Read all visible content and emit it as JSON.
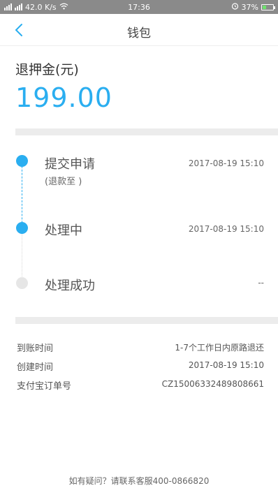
{
  "status_bar": {
    "network_speed": "42.0 K/s",
    "time": "17:36",
    "battery": "37%",
    "battery_level": 0.37,
    "battery_color": "#6ee26e"
  },
  "nav": {
    "title": "钱包",
    "back_icon": "chevron-left-icon"
  },
  "deposit": {
    "label": "退押金(元)",
    "amount": "199.00",
    "accent_color": "#2aaef0"
  },
  "timeline": [
    {
      "title": "提交申请",
      "subtitle": "(退款至 )",
      "time": "2017-08-19 15:10",
      "status": "done"
    },
    {
      "title": "处理中",
      "subtitle": "",
      "time": "2017-08-19 15:10",
      "status": "done"
    },
    {
      "title": "处理成功",
      "subtitle": "",
      "time": "--",
      "status": "pending"
    }
  ],
  "details": [
    {
      "label": "到账时间",
      "value": "1-7个工作日内原路退还"
    },
    {
      "label": "创建时间",
      "value": "2017-08-19 15:10"
    },
    {
      "label": "支付宝订单号",
      "value": "CZ15006332489808661"
    }
  ],
  "footer": {
    "help_text": "如有疑问？请联系客服400-0866820"
  }
}
